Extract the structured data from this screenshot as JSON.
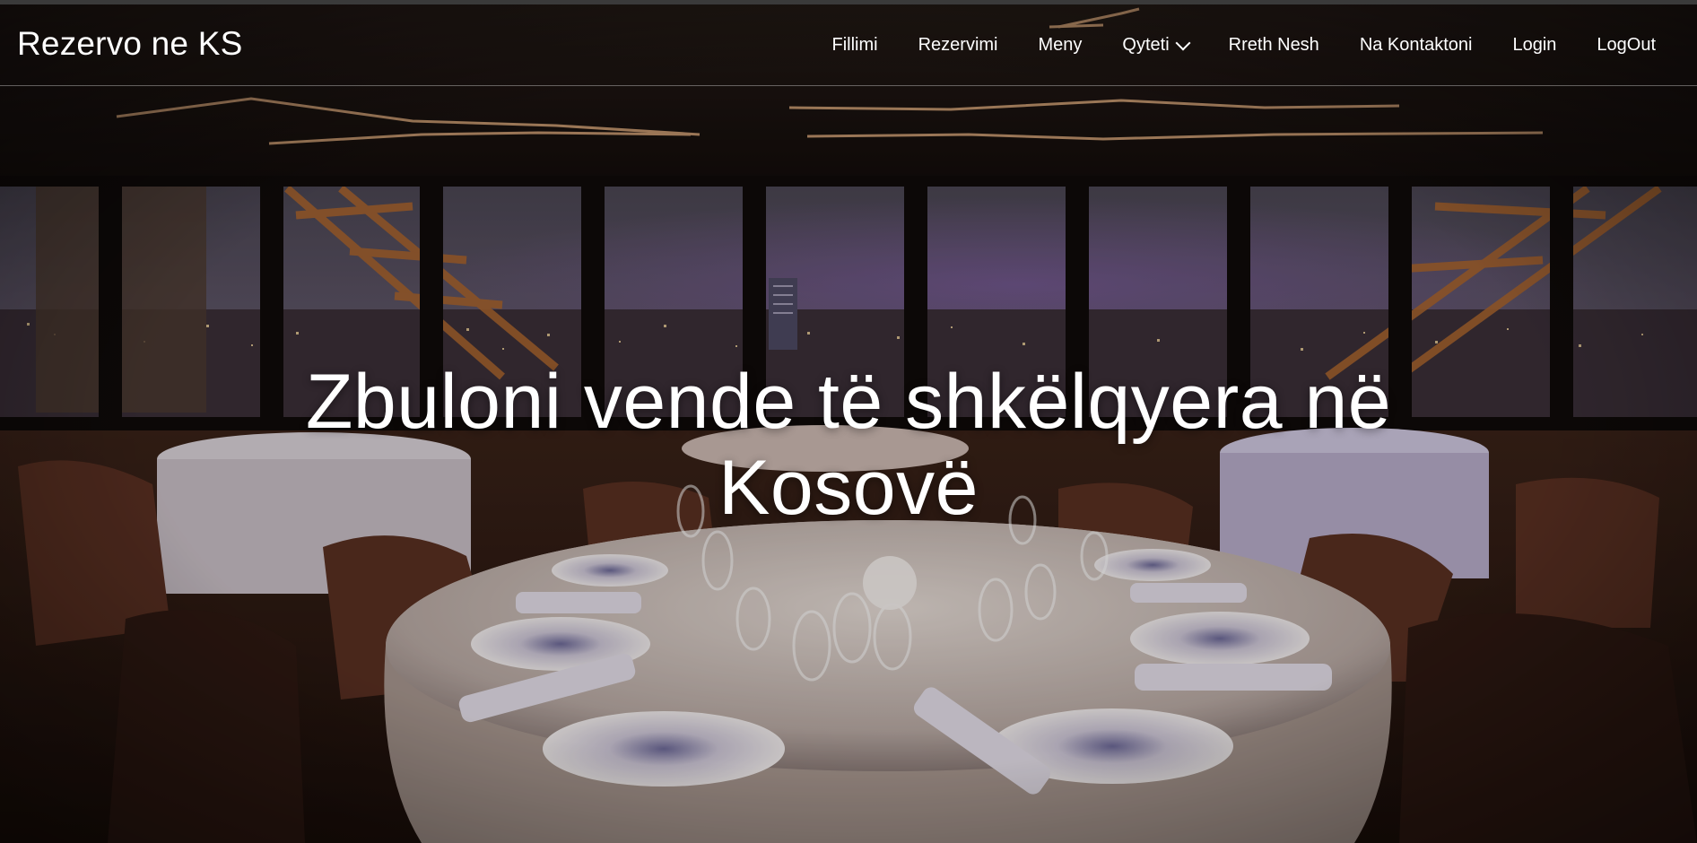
{
  "brand": {
    "name": "Rezervo ne KS"
  },
  "nav": {
    "items": [
      {
        "label": "Fillimi"
      },
      {
        "label": "Rezervimi"
      },
      {
        "label": "Meny"
      },
      {
        "label": "Qyteti",
        "dropdown": true
      },
      {
        "label": "Rreth Nesh"
      },
      {
        "label": "Na Kontaktoni"
      },
      {
        "label": "Login"
      },
      {
        "label": "LogOut"
      }
    ]
  },
  "hero": {
    "title_line1": "Zbuloni vende të shkëlqyera në",
    "title_line2": "Kosovë",
    "background": "restaurant-interior-night-city-view"
  },
  "colors": {
    "nav_text": "#ffffff",
    "hero_text": "#ffffff",
    "nav_divider": "rgba(255,255,255,0.35)"
  },
  "icons": {
    "dropdown": "chevron-down-icon"
  }
}
